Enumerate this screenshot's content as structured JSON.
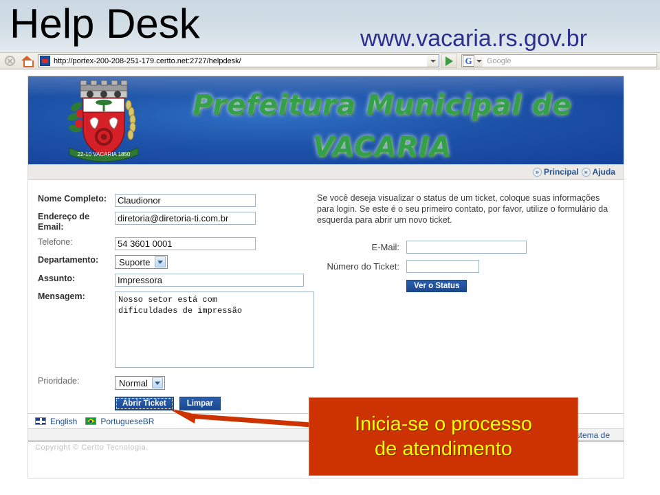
{
  "slide": {
    "title": "Help Desk",
    "site_url": "www.vacaria.rs.gov.br"
  },
  "browser": {
    "stop_icon": "stop-icon",
    "home_icon": "home-icon",
    "url": "http://portex-200-208-251-179.certto.net:2727/helpdesk/",
    "url_dropdown_icon": "chevron-down-icon",
    "go_icon": "go-arrow-icon",
    "search_engine_icon": "google-g-icon",
    "search_placeholder": "Google"
  },
  "banner": {
    "crest_icon": "vacaria-coat-of-arms-icon",
    "line1": "Prefeitura Municipal de",
    "line2": "VACARIA",
    "crest_motto": "22-10  VACARIA  1850"
  },
  "nav": {
    "items": [
      {
        "label": "Principal",
        "icon": "chevron-double-right-icon"
      },
      {
        "label": "Ajuda",
        "icon": "chevron-double-right-icon"
      }
    ]
  },
  "ticket_form": {
    "name_label": "Nome Completo:",
    "name_value": "Claudionor",
    "email_label": "Endereço de Email:",
    "email_value": "diretoria@diretoria-ti.com.br",
    "phone_label": "Telefone:",
    "phone_value": "54 3601 0001",
    "department_label": "Departamento:",
    "department_value": "Suporte",
    "subject_label": "Assunto:",
    "subject_value": "Impressora",
    "message_label": "Mensagem:",
    "message_value": "Nosso setor está com\ndificuldades de impressão",
    "priority_label": "Prioridade:",
    "priority_value": "Normal",
    "submit_label": "Abrir Ticket",
    "clear_label": "Limpar",
    "dropdown_icon": "chevron-down-icon"
  },
  "status_panel": {
    "intro": "Se você deseja visualizar o status de um ticket, coloque suas informações para login. Se este é o seu primeiro contato, por favor, utilize o formulário da esquerda para abrir um novo ticket.",
    "email_label": "E-Mail:",
    "email_value": "",
    "ticket_label": "Número do Ticket:",
    "ticket_value": "",
    "button_label": "Ver o Status"
  },
  "footer": {
    "lang_en_label": "English",
    "lang_en_icon": "uk-flag-icon",
    "lang_pt_label": "PortugueseBR",
    "lang_pt_icon": "brazil-flag-icon",
    "system_text": "Sistema de",
    "copyright": "Copyright © Certto Tecnologia."
  },
  "annotation": {
    "line1": "Inicia-se o processo",
    "line2": "de atendimento",
    "color": "#cc3300",
    "text_color": "#ffff00",
    "arrow_icon": "pointer-arrow-icon"
  }
}
